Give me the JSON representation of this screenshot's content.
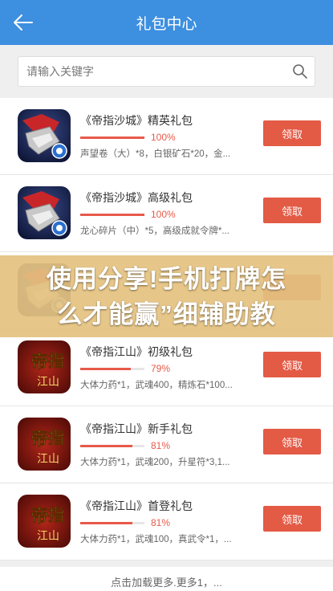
{
  "header": {
    "title": "礼包中心"
  },
  "search": {
    "placeholder": "请输入关键字"
  },
  "items": [
    {
      "title": "《帝指沙城》精英礼包",
      "percent": "100%",
      "progress": 1.0,
      "desc": "声望卷（大）*8，白银矿石*20，金...",
      "button": "领取",
      "icon": "sand-city-game-icon"
    },
    {
      "title": "《帝指沙城》高级礼包",
      "percent": "100%",
      "progress": 1.0,
      "desc": "龙心碎片（中）*5，高级成就令牌*...",
      "button": "领取",
      "icon": "sand-city-game-icon"
    },
    {
      "title": "",
      "percent": "",
      "progress": 1.0,
      "desc": "",
      "button": "",
      "icon": "sand-city-game-icon"
    },
    {
      "title": "《帝指江山》初级礼包",
      "percent": "79%",
      "progress": 0.79,
      "desc": "大体力药*1，武魂400，精炼石*100...",
      "button": "领取",
      "icon": "jiangshan-game-icon"
    },
    {
      "title": "《帝指江山》新手礼包",
      "percent": "81%",
      "progress": 0.81,
      "desc": "大体力药*1，武魂200，升星符*3,1...",
      "button": "领取",
      "icon": "jiangshan-game-icon"
    },
    {
      "title": "《帝指江山》首登礼包",
      "percent": "81%",
      "progress": 0.81,
      "desc": "大体力药*1，武魂100，真武令*1，...",
      "button": "领取",
      "icon": "jiangshan-game-icon"
    }
  ],
  "load_more": "点击加载更多.更多1，...",
  "overlay": {
    "line1": "使用分享!手机打牌怎",
    "line2": "么才能赢”细辅助教"
  },
  "colors": {
    "header": "#3d8fe0",
    "button": "#e35a45",
    "progress": "#e8594a",
    "overlay": "#e4c280"
  }
}
